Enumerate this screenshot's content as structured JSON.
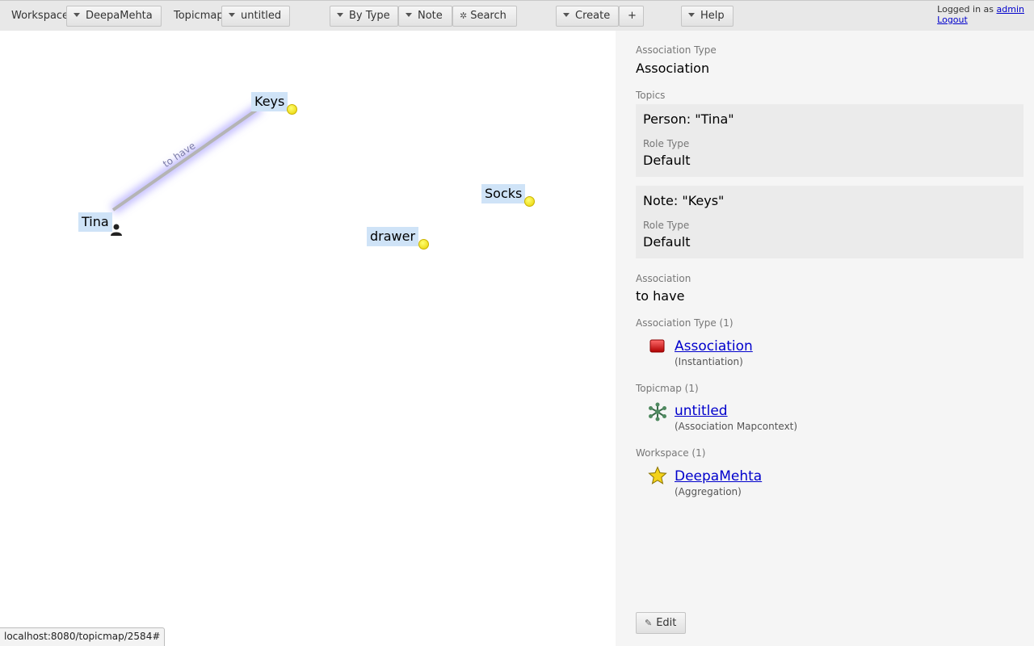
{
  "toolbar": {
    "workspace_label": "Workspace",
    "workspace_value": "DeepaMehta",
    "topicmap_label": "Topicmap",
    "topicmap_value": "untitled",
    "by_type": "By Type",
    "note": "Note",
    "search": "Search",
    "create": "Create",
    "plus": "+",
    "help": "Help",
    "logged_in_as": "Logged in as",
    "username": "admin",
    "logout": "Logout"
  },
  "canvas": {
    "topics": [
      "Keys",
      "Tina",
      "Socks",
      "drawer"
    ],
    "association_label": "to have"
  },
  "panel": {
    "assoc_type_label": "Association Type",
    "assoc_type_value": "Association",
    "topics_label": "Topics",
    "topic1": {
      "title": "Person: \"Tina\"",
      "role_label": "Role Type",
      "role_value": "Default"
    },
    "topic2": {
      "title": "Note: \"Keys\"",
      "role_label": "Role Type",
      "role_value": "Default"
    },
    "association_label": "Association",
    "association_value": "to have",
    "related": [
      {
        "heading": "Association Type (1)",
        "link": "Association",
        "sub": "(Instantiation)",
        "icon": "association-type-icon"
      },
      {
        "heading": "Topicmap (1)",
        "link": "untitled",
        "sub": "(Association Mapcontext)",
        "icon": "topicmap-icon"
      },
      {
        "heading": "Workspace (1)",
        "link": "DeepaMehta",
        "sub": "(Aggregation)",
        "icon": "star-icon"
      }
    ],
    "edit": "Edit"
  },
  "status_url": "localhost:8080/topicmap/2584#",
  "colors": {
    "accent_link": "#0000cc",
    "topic_bg": "#cfe3f7",
    "panel_bg": "#f5f5f5",
    "toolbar_bg": "#e8e8e8"
  }
}
